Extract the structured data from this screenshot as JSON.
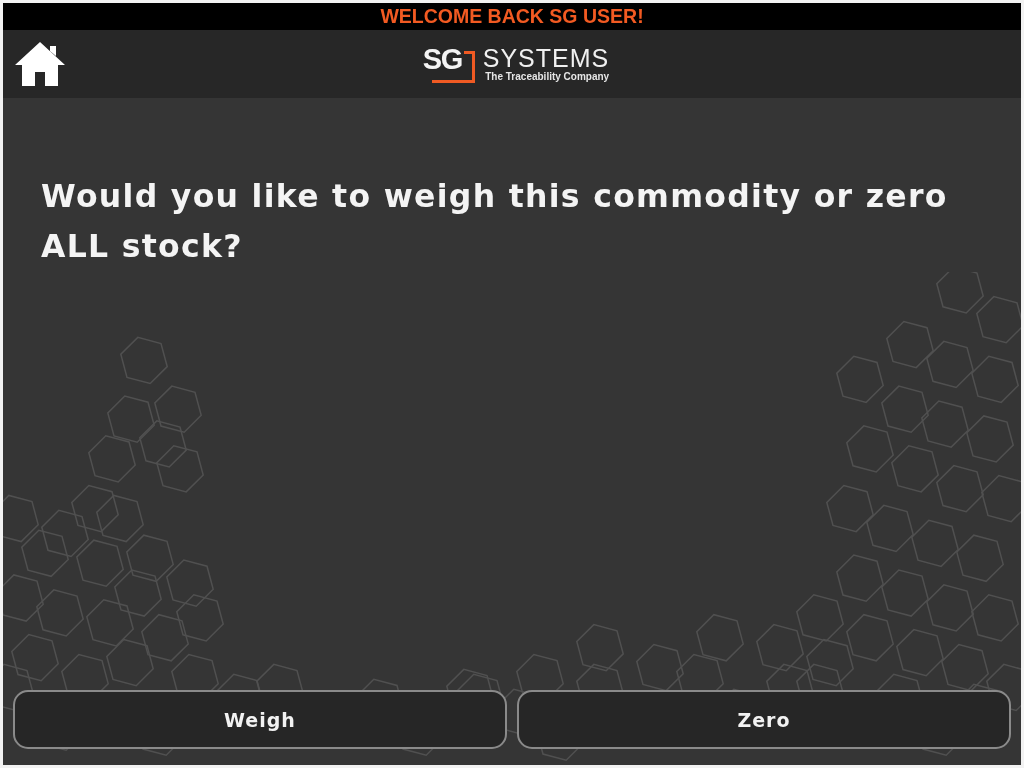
{
  "banner": {
    "text": "WELCOME BACK SG USER!"
  },
  "header": {
    "logo": {
      "mark": "SG",
      "name": "SYSTEMS",
      "tagline": "The Traceability Company"
    }
  },
  "prompt": {
    "text": "Would you like to weigh this commodity or zero ALL stock?"
  },
  "buttons": [
    {
      "label": "Weigh"
    },
    {
      "label": "Zero"
    }
  ]
}
